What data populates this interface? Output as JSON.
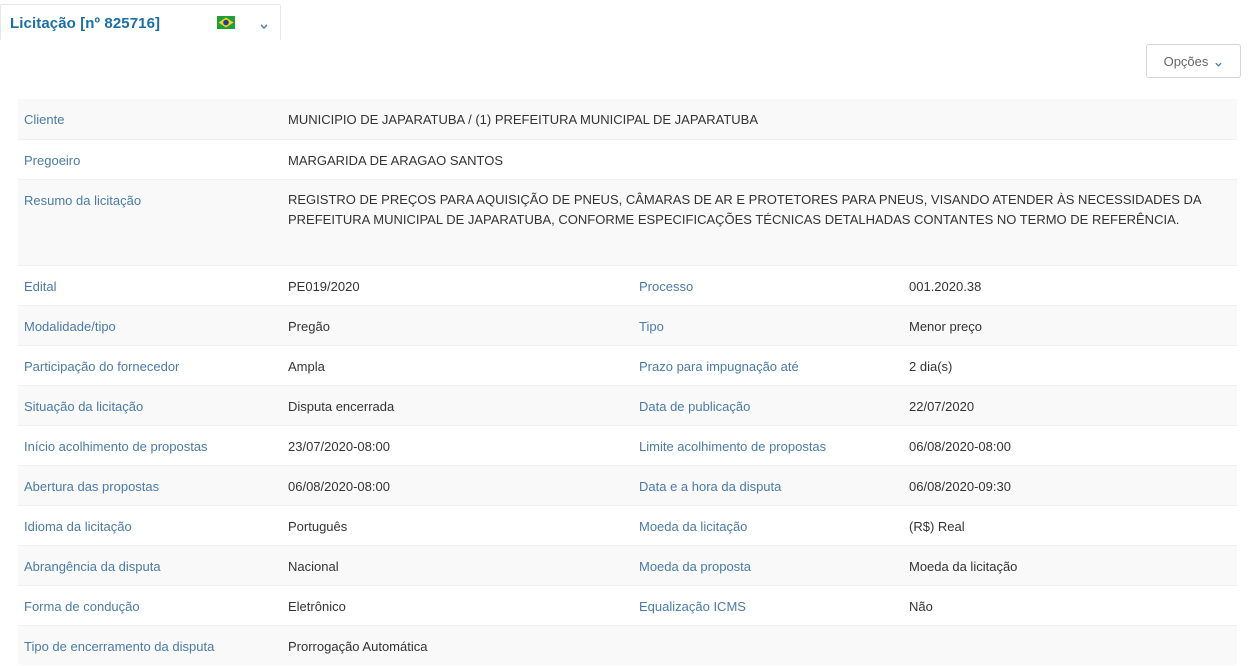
{
  "tab": {
    "title": "Licitação [nº 825716]",
    "flag_icon": "brazil-flag-icon",
    "chevron_icon": "chevron-down-icon"
  },
  "options_button": {
    "label": "Opções",
    "icon": "chevron-down-icon"
  },
  "colors": {
    "label": "#4a7ba8",
    "title": "#1a6ea6",
    "value": "#333333",
    "stripe": "#f9f9f9"
  },
  "single_rows": [
    {
      "label": "Cliente",
      "value": "MUNICIPIO DE JAPARATUBA / (1) PREFEITURA MUNICIPAL DE JAPARATUBA"
    },
    {
      "label": "Pregoeiro",
      "value": "MARGARIDA DE ARAGAO SANTOS"
    },
    {
      "label": "Resumo da licitação",
      "value": "REGISTRO DE PREÇOS PARA AQUISIÇÃO DE PNEUS, CÂMARAS DE AR E PROTETORES PARA PNEUS, VISANDO ATENDER ÀS NECESSIDADES DA PREFEITURA MUNICIPAL DE JAPARATUBA, CONFORME ESPECIFICAÇÕES TÉCNICAS DETALHADAS CONTANTES NO TERMO DE REFERÊNCIA."
    }
  ],
  "pair_rows": [
    {
      "label": "Edital",
      "value": "PE019/2020",
      "label2": "Processo",
      "value2": "001.2020.38"
    },
    {
      "label": "Modalidade/tipo",
      "value": "Pregão",
      "label2": "Tipo",
      "value2": "Menor preço"
    },
    {
      "label": "Participação do fornecedor",
      "value": "Ampla",
      "label2": "Prazo para impugnação até",
      "value2": "2 dia(s)"
    },
    {
      "label": "Situação da licitação",
      "value": "Disputa encerrada",
      "label2": "Data de publicação",
      "value2": "22/07/2020"
    },
    {
      "label": "Início acolhimento de propostas",
      "value": "23/07/2020-08:00",
      "label2": "Limite acolhimento de propostas",
      "value2": "06/08/2020-08:00"
    },
    {
      "label": "Abertura das propostas",
      "value": "06/08/2020-08:00",
      "label2": "Data e a hora da disputa",
      "value2": "06/08/2020-09:30"
    },
    {
      "label": "Idioma da licitação",
      "value": "Português",
      "label2": "Moeda da licitação",
      "value2": "(R$) Real"
    },
    {
      "label": "Abrangência da disputa",
      "value": "Nacional",
      "label2": "Moeda da proposta",
      "value2": "Moeda da licitação"
    },
    {
      "label": "Forma de condução",
      "value": "Eletrônico",
      "label2": "Equalização ICMS",
      "value2": "Não"
    },
    {
      "label": "Tipo de encerramento da disputa",
      "value": "Prorrogação Automática",
      "label2": "",
      "value2": ""
    }
  ]
}
